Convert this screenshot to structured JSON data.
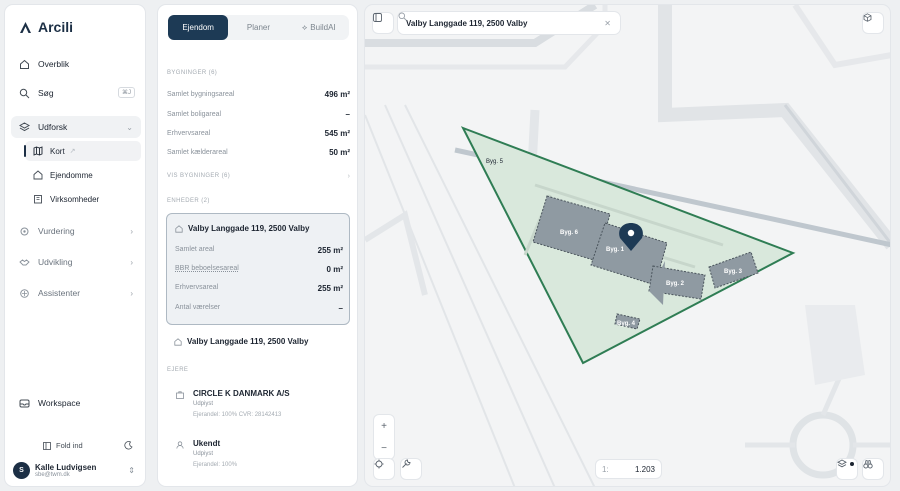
{
  "app": {
    "name": "Arcili"
  },
  "sidebar": {
    "items": [
      {
        "label": "Overblik"
      },
      {
        "label": "Søg",
        "shortcut": "⌘J"
      },
      {
        "label": "Udforsk"
      },
      {
        "label": "Vurdering"
      },
      {
        "label": "Udvikling"
      },
      {
        "label": "Assistenter"
      },
      {
        "label": "Workspace"
      }
    ],
    "subitems": [
      {
        "label": "Kort"
      },
      {
        "label": "Ejendomme"
      },
      {
        "label": "Virksomheder"
      }
    ],
    "fold_label": "Fold ind",
    "user": {
      "initial": "S",
      "name": "Kalle Ludvigsen",
      "email": "sbe@twm.dk"
    }
  },
  "panel": {
    "tabs": [
      {
        "label": "Ejendom"
      },
      {
        "label": "Planer"
      },
      {
        "label": "BuildAI"
      }
    ],
    "buildings_section": "BYGNINGER (6)",
    "building_rows": [
      {
        "label": "Samlet bygningsareal",
        "value": "496 m²"
      },
      {
        "label": "Samlet boligareal",
        "value": "–"
      },
      {
        "label": "Erhvervsareal",
        "value": "545 m²"
      },
      {
        "label": "Samlet kælderareal",
        "value": "50 m²"
      }
    ],
    "show_buildings": "VIS BYGNINGER (6)",
    "units_section": "ENHEDER (2)",
    "unit1": {
      "title": "Valby Langgade 119, 2500 Valby",
      "rows": [
        {
          "label": "Samlet areal",
          "value": "255 m²"
        },
        {
          "label": "BBR beboelsesareal",
          "value": "0 m²"
        },
        {
          "label": "Erhvervsareal",
          "value": "255 m²"
        },
        {
          "label": "Antal værelser",
          "value": "–"
        }
      ]
    },
    "unit2": {
      "title": "Valby Langgade 119, 2500 Valby"
    },
    "owners_section": "EJERE",
    "owners": [
      {
        "name": "CIRCLE K DANMARK A/S",
        "status": "Udpiyst",
        "detail": "Ejerandel: 100%   CVR: 28142413"
      },
      {
        "name": "Ukendt",
        "status": "Udpiyst",
        "detail": "Ejerandel: 100%"
      }
    ]
  },
  "map": {
    "search_value": "Valby Langgade 119, 2500 Valby",
    "zoom_in": "+",
    "zoom_out": "−",
    "scale_prefix": "1:",
    "scale_value": "1.203",
    "buildings": [
      {
        "label": "Byg. 5"
      },
      {
        "label": "Byg. 6"
      },
      {
        "label": "Byg. 1"
      },
      {
        "label": "Byg. 2"
      },
      {
        "label": "Byg. 3"
      },
      {
        "label": "Byg. 4"
      }
    ],
    "colors": {
      "parcel_stroke": "#2f7d54",
      "parcel_fill": "#d9e8dc",
      "building_fill": "#8f9aa2",
      "accent": "#1d3a55"
    }
  }
}
